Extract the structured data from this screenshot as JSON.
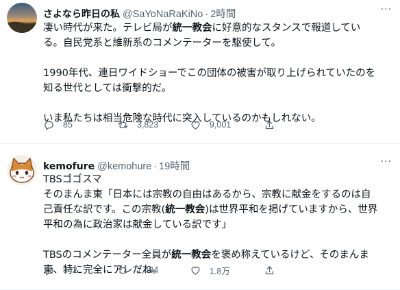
{
  "tweets": [
    {
      "author_name": "さよなら昨日の私",
      "handle": "@SaYoNaRaKiNo",
      "separator": "·",
      "time": "2時間",
      "more_label": "···",
      "body": {
        "line1_pre": "凄い時代が来た。テレビ局が",
        "line1_hl": "統一教会",
        "line1_post": "に好意的なスタンスで報道してい",
        "line2": "る。自民党系と維新系のコメンテーターを駆使して。",
        "line3": "1990年代、連日ワイドショーでこの団体の被害が取り上げられていたのを",
        "line4": "知る世代としては衝撃的だ。",
        "line5": "いま私たちは相当危険な時代に突入しているのかもしれない。"
      },
      "replies": "85",
      "retweets": "3,823",
      "likes": "9,001",
      "avatar_icon": "sunset-photo-avatar"
    },
    {
      "author_name": "kemofure",
      "handle": "@kemohure",
      "separator": "·",
      "time": "19時間",
      "more_label": "···",
      "body": {
        "line1": "TBSゴゴスマ",
        "line2": "そのまんま東「日本には宗教の自由はあるから、宗教に献金をするのは自",
        "line3_pre": "己責任な訳です。この宗教(",
        "line3_hl": "統一教会",
        "line3_post": ")は世界平和を掲げていますから、世界",
        "line4": "平和の為に政治家は献金している訳です」",
        "line5_pre": "TBSのコメンテーター全員が",
        "line5_hl": "統一教会",
        "line5_post": "を褒め称えているけど、そのまんま",
        "line6": "東、特に完全にアレだね。"
      },
      "replies": "342",
      "retweets": "7,494",
      "likes": "1.8万",
      "avatar_icon": "cat-cartoon-avatar"
    }
  ],
  "colors": {
    "text": "#0f1419",
    "secondary": "#536471",
    "divider": "#eff3f4"
  }
}
